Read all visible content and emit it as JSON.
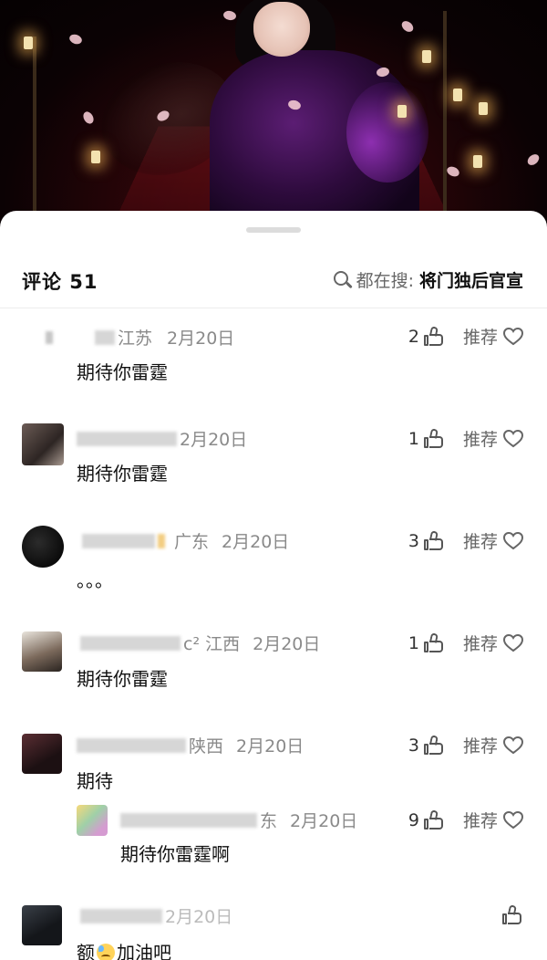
{
  "header": {
    "title": "评论 51",
    "search_prefix": "都在搜:",
    "search_keyword": "将门独后官宣"
  },
  "actions": {
    "recommend_label": "推荐"
  },
  "comments": [
    {
      "username_visible": "江苏",
      "date": "2月20日",
      "likes": "2",
      "text": "期待你雷霆"
    },
    {
      "username_visible": "",
      "date": "2月20日",
      "likes": "1",
      "text": "期待你雷霆"
    },
    {
      "username_visible": "广东",
      "date": "2月20日",
      "likes": "3",
      "text": "。。。"
    },
    {
      "username_visible": "c² 江西",
      "date": "2月20日",
      "likes": "1",
      "text": "期待你雷霆"
    },
    {
      "username_visible": "陕西",
      "date": "2月20日",
      "likes": "3",
      "text": "期待"
    },
    {
      "username_visible": "东",
      "date": "2月20日",
      "likes": "9",
      "text": "期待你雷霆啊",
      "is_reply": true
    },
    {
      "username_visible": "",
      "date": "2月20日",
      "likes": "",
      "text_before": "额",
      "text_after": "加油吧"
    }
  ],
  "icons": {
    "search": "search-icon",
    "like": "thumbs-up-icon",
    "recommend": "heart-icon"
  },
  "colors": {
    "meta_gray": "#8a8a8a",
    "text": "#111111",
    "divider": "#ededed"
  }
}
